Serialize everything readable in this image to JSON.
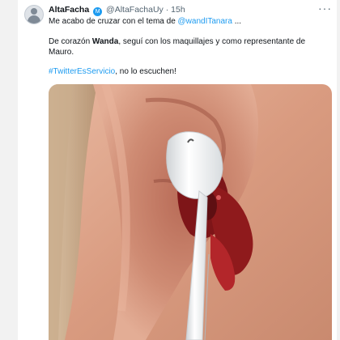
{
  "tweet": {
    "display_name": "AltaFacha",
    "badge": "M",
    "handle": "@AltaFachaUy",
    "separator": "·",
    "time": "15h",
    "more": "···",
    "line1_prefix": "Me acabo de cruzar con el tema de ",
    "line1_mention": "@wandITanara",
    "line1_suffix": " ...",
    "line2_a": "De corazón ",
    "line2_bold": "Wanda",
    "line2_b": ", seguí con los maquillajes y como representante de",
    "line3": "Mauro.",
    "line4_hashtag": "#TwitterEsServicio",
    "line4_suffix": ", no lo escuchen!"
  },
  "colors": {
    "link": "#1d9bf0",
    "muted": "#536471",
    "text": "#0f1419"
  },
  "media": {
    "subject": "ear-with-earbud-and-blood"
  }
}
